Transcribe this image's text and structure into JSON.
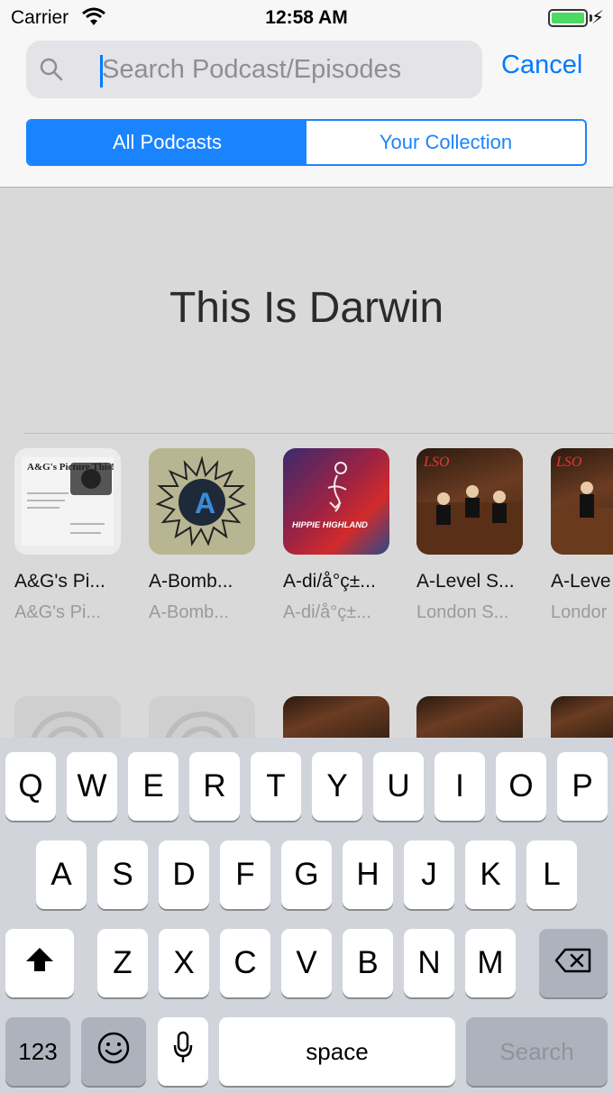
{
  "status_bar": {
    "carrier": "Carrier",
    "time": "12:58 AM"
  },
  "search": {
    "placeholder": "Search Podcast/Episodes",
    "value": "",
    "cancel_label": "Cancel"
  },
  "segments": [
    {
      "label": "All Podcasts",
      "active": true
    },
    {
      "label": "Your Collection",
      "active": false
    }
  ],
  "section": {
    "title": "This Is Darwin"
  },
  "podcasts": [
    {
      "title": "A&G's Pi...",
      "subtitle": "A&G's Pi...",
      "art_text": "A&G's Picture This!"
    },
    {
      "title": "A-Bomb...",
      "subtitle": "A-Bomb...",
      "art_text": "A"
    },
    {
      "title": "A-di/å°ç±...",
      "subtitle": "A-di/å°ç±...",
      "art_text": "HIPPIE HIGHLAND"
    },
    {
      "title": "A-Level S...",
      "subtitle": "London S...",
      "art_text": "LSO"
    },
    {
      "title": "A-Leve",
      "subtitle": "Londor",
      "art_text": "LSO"
    }
  ],
  "keyboard": {
    "row1": [
      "Q",
      "W",
      "E",
      "R",
      "T",
      "Y",
      "U",
      "I",
      "O",
      "P"
    ],
    "row2": [
      "A",
      "S",
      "D",
      "F",
      "G",
      "H",
      "J",
      "K",
      "L"
    ],
    "row3": [
      "Z",
      "X",
      "C",
      "V",
      "B",
      "N",
      "M"
    ],
    "numbers_label": "123",
    "space_label": "space",
    "search_label": "Search"
  },
  "colors": {
    "accent": "#1a84ff",
    "battery": "#4cd964",
    "keyboard_bg": "#d1d4da"
  }
}
